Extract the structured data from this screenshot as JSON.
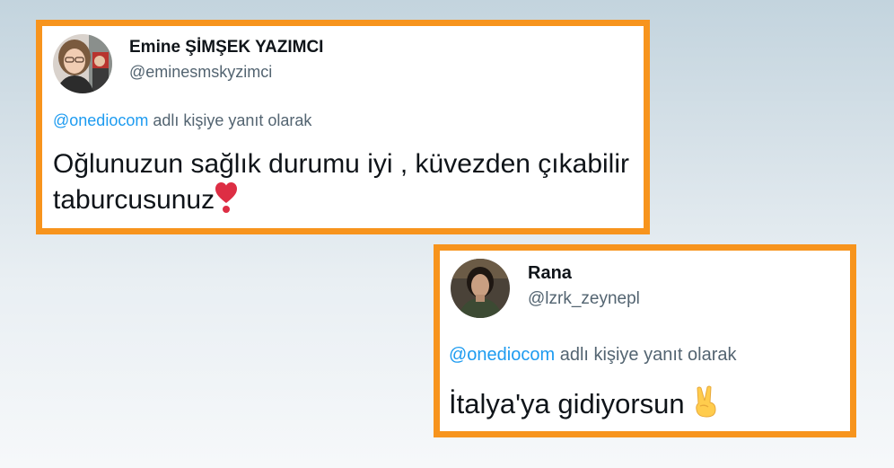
{
  "colors": {
    "frame_border": "#f7941d",
    "mention": "#1d9bf0",
    "secondary_text": "#536471",
    "primary_text": "#0f1419"
  },
  "tweets": [
    {
      "display_name": "Emine ŞİMŞEK YAZIMCI",
      "handle": "@eminesmskyzimci",
      "reply_mention": "@onediocom",
      "reply_suffix": " adlı kişiye yanıt olarak",
      "text_line1": "Oğlunuzun sağlık durumu iyi , küvezden çıkabilir",
      "text_line2": "taburcusunuz",
      "emoji": "heavy-heart-exclamation-icon"
    },
    {
      "display_name": "Rana",
      "handle": "@lzrk_zeynepl",
      "reply_mention": "@onediocom",
      "reply_suffix": " adlı kişiye yanıt olarak",
      "text_line1": "İtalya'ya gidiyorsun ",
      "emoji": "victory-hand-icon"
    }
  ]
}
